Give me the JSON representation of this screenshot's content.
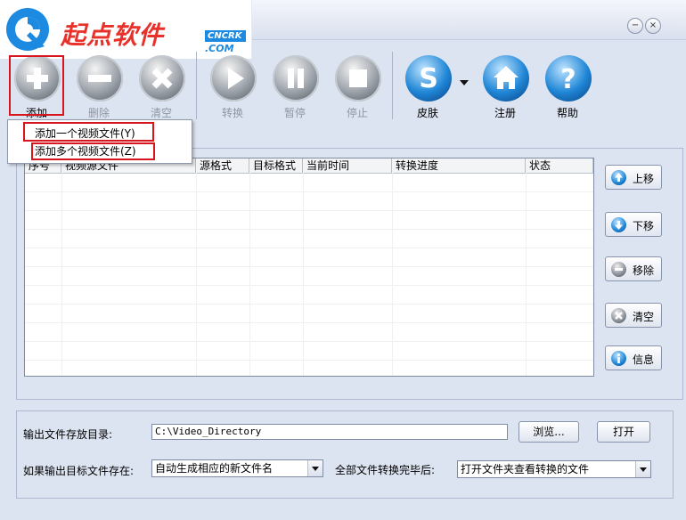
{
  "logo": {
    "brand_text": "起点软件",
    "badge_top": "CNCRK",
    "badge_bottom": ".COM"
  },
  "window": {
    "min": "−",
    "close": "×"
  },
  "toolbar": {
    "add": "添加",
    "delete": "删除",
    "clear": "清空",
    "convert": "转换",
    "pause": "暂停",
    "stop": "停止",
    "skin": "皮肤",
    "register": "注册",
    "help": "帮助"
  },
  "add_menu": {
    "item1": "添加一个视频文件(Y)",
    "item2": "添加多个视频文件(Z)"
  },
  "table": {
    "columns": [
      "序号",
      "视频源文件",
      "源格式",
      "目标格式",
      "当前时间",
      "转换进度",
      "状态"
    ],
    "rows": []
  },
  "side_buttons": {
    "move_up": "上移",
    "move_down": "下移",
    "remove": "移除",
    "clear": "清空",
    "info": "信息"
  },
  "output": {
    "dir_label": "输出文件存放目录:",
    "dir_value": "C:\\Video_Directory",
    "browse": "浏览...",
    "open": "打开",
    "exists_label": "如果输出目标文件存在:",
    "exists_value": "自动生成相应的新文件名",
    "after_label": "全部文件转换完毕后:",
    "after_value": "打开文件夹查看转换的文件"
  },
  "colors": {
    "accent": "#1f86d6",
    "highlight": "#d8141c"
  }
}
